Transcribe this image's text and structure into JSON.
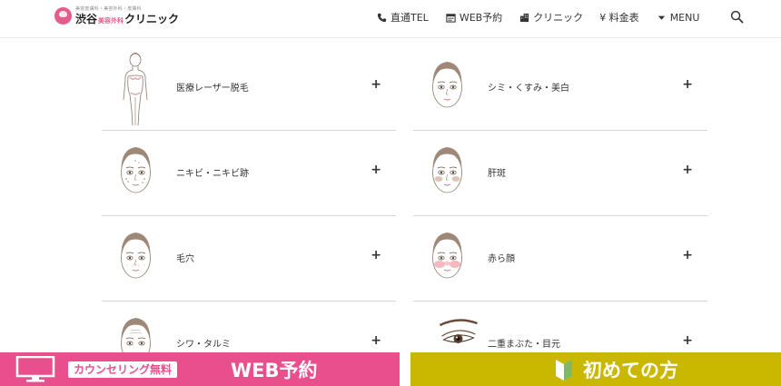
{
  "header": {
    "logo": {
      "subtitle": "美容皮膚科・美容外科・皮膚科",
      "name_a": "渋谷",
      "name_pink": "美容外科",
      "name_b": "クリニック"
    },
    "nav": [
      {
        "label": "直通TEL",
        "icon": "phone-icon"
      },
      {
        "label": "WEB予約",
        "icon": "calendar-icon"
      },
      {
        "label": "クリニック",
        "icon": "building-icon"
      },
      {
        "label": "¥ 料金表",
        "icon": "yen-icon"
      },
      {
        "label": "MENU",
        "icon": "caret-down-icon"
      }
    ],
    "search_icon": "search-icon"
  },
  "menu_cards": [
    {
      "label": "医療レーザー脱毛",
      "illustration": "body-figure"
    },
    {
      "label": "シミ・くすみ・美白",
      "illustration": "face"
    },
    {
      "label": "ニキビ・ニキビ跡",
      "illustration": "face-acne"
    },
    {
      "label": "肝斑",
      "illustration": "face-melasma"
    },
    {
      "label": "毛穴",
      "illustration": "face-pores"
    },
    {
      "label": "赤ら顔",
      "illustration": "face-redness"
    },
    {
      "label": "シワ・タルミ",
      "illustration": "face-wrinkles"
    },
    {
      "label": "二重まぶた・目元",
      "illustration": "eye-closeup"
    }
  ],
  "expand_symbol": "+",
  "cta": {
    "left": {
      "badge": "カウンセリング無料",
      "text": "WEB予約",
      "color": "#e94f8d",
      "icon": "monitor-icon"
    },
    "right": {
      "text": "初めての方",
      "color": "#c9b700",
      "icon": "beginner-leaf-icon"
    }
  }
}
